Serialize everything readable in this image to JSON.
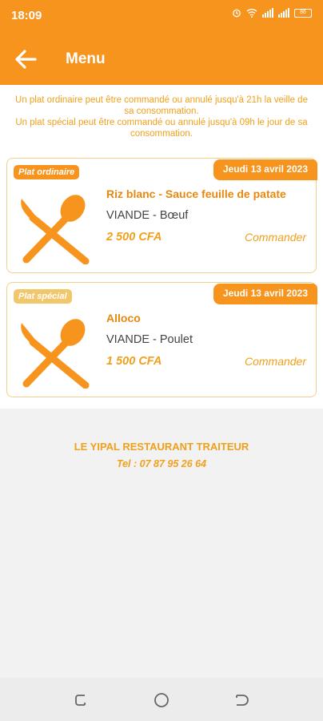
{
  "status_bar": {
    "time": "18:09",
    "battery": "86"
  },
  "app_bar": {
    "title": "Menu"
  },
  "notice": {
    "line1": "Un plat ordinaire peut être commandé ou annulé jusqu'à 21h la veille de sa consommation.",
    "line2": "Un plat spécial peut être commandé ou annulé jusqu'à 09h le jour de sa consommation."
  },
  "dishes": [
    {
      "badge": "Plat ordinaire",
      "date": "Jeudi 13 avril 2023",
      "name": "Riz blanc - Sauce feuille de patate",
      "meat": "VIANDE - Bœuf",
      "price": "2 500 CFA",
      "action": "Commander"
    },
    {
      "badge": "Plat spécial",
      "date": "Jeudi 13 avril 2023",
      "name": "Alloco",
      "meat": "VIANDE - Poulet",
      "price": "1 500 CFA",
      "action": "Commander"
    }
  ],
  "footer": {
    "name": "LE YIPAL RESTAURANT TRAITEUR",
    "tel": "Tel : 07 87 95 26 64"
  },
  "colors": {
    "primary": "#f7941d",
    "accent_light": "#f2c76c",
    "text_orange": "#f0a01c"
  },
  "icons": {
    "back": "arrow-left-icon",
    "dish": "fork-spoon-icon",
    "nav_recent": "recent-apps-icon",
    "nav_home": "home-icon",
    "nav_back": "nav-back-icon"
  }
}
